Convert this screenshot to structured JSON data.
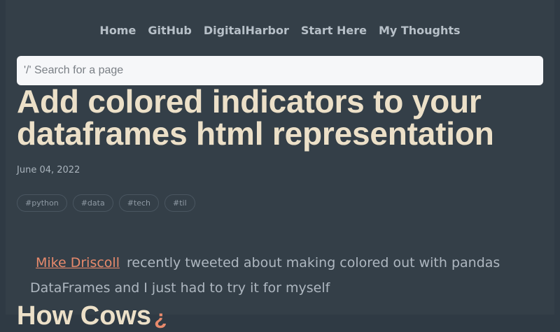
{
  "nav": {
    "items": [
      "Home",
      "GitHub",
      "DigitalHarbor",
      "Start Here",
      "My Thoughts"
    ]
  },
  "search": {
    "placeholder": "'/' Search for a page"
  },
  "post": {
    "title_line1": "Add colored indicators to your",
    "title_line2": "dataframes html representation",
    "date": "June 04, 2022",
    "tags": [
      "#python",
      "#data",
      "#tech",
      "#til"
    ],
    "author_link": "Mike Driscoll",
    "intro_rest": "recently tweeted about making colored out with pandas DataFrames and I just had to try it for myself",
    "next_heading": "How Cows"
  },
  "colors": {
    "background": "#343f48",
    "title": "#ece0c8",
    "link": "#e88a6c",
    "text": "#aeb7c0"
  }
}
